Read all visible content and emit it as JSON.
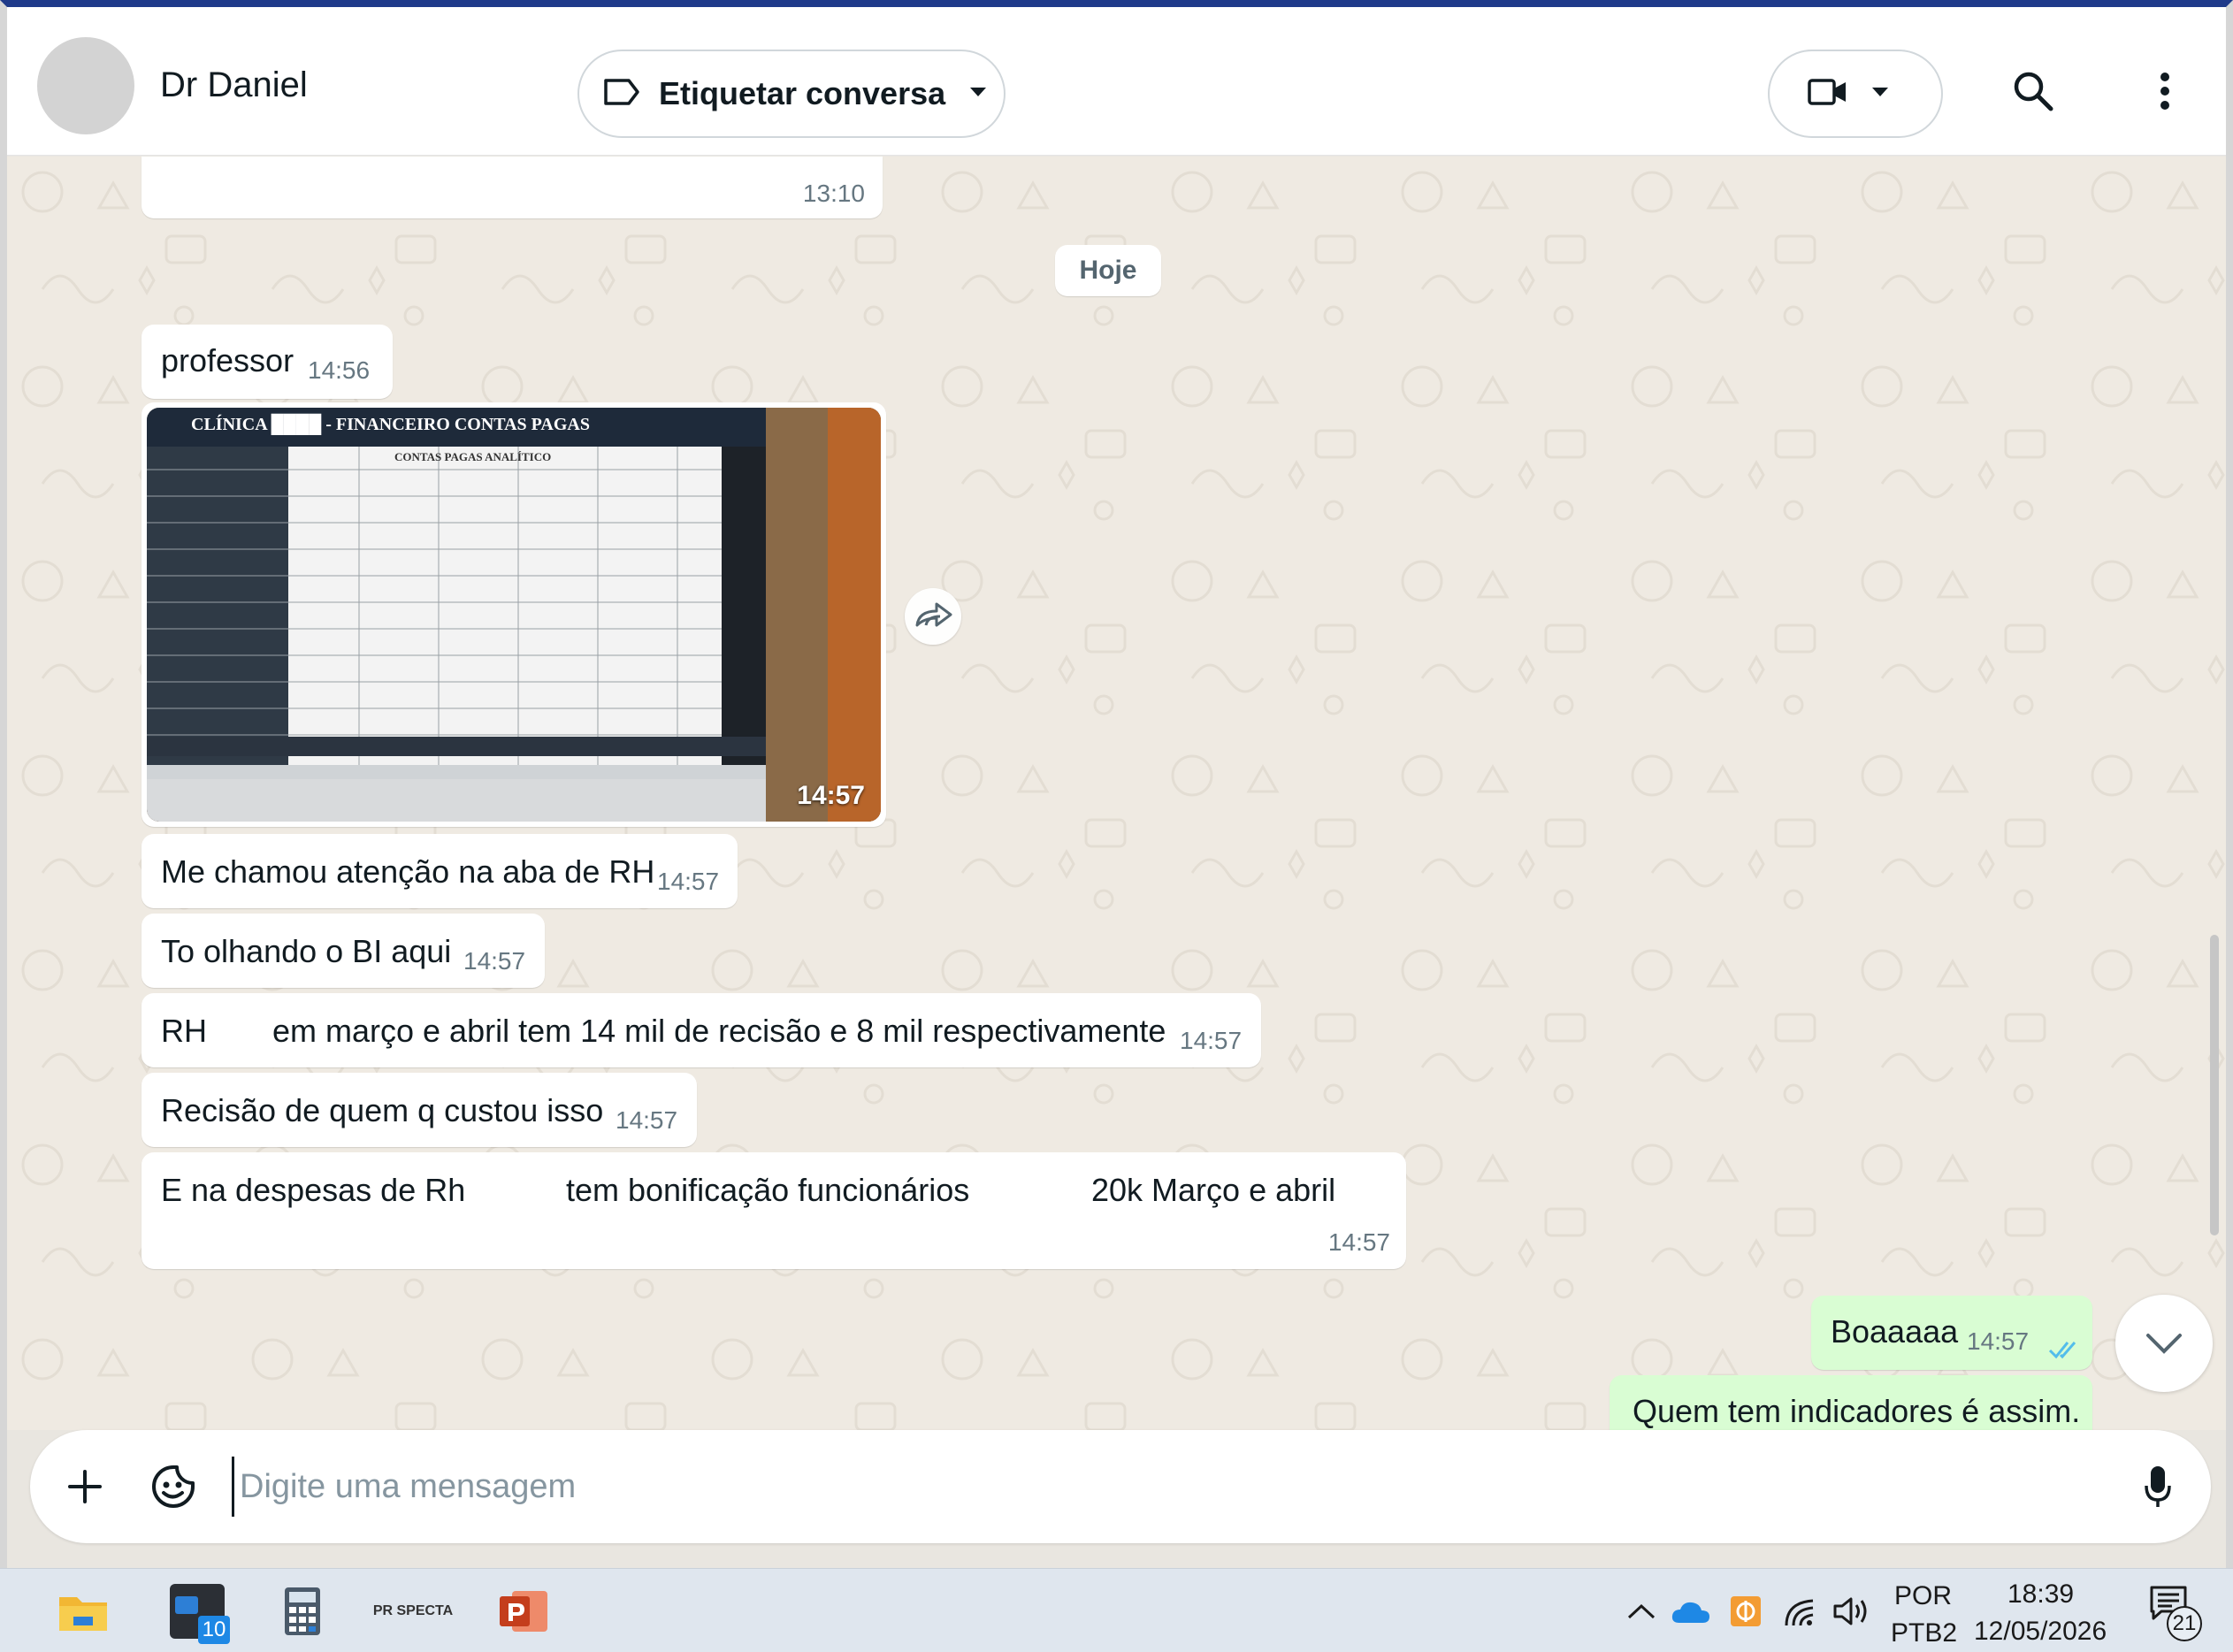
{
  "header": {
    "contact_name": "Dr Daniel",
    "label_button": "Etiquetar conversa"
  },
  "chat": {
    "date_divider": "Hoje",
    "prev_message_time": "13:10",
    "messages": [
      {
        "segments": [
          "professor"
        ],
        "time": "14:56"
      },
      {
        "type": "image",
        "image_caption_visible": "CLÍNICA ████ - FINANCEIRO CONTAS PAGAS",
        "image_subtitle": "CONTAS PAGAS ANALÍTICO",
        "time": "14:57"
      },
      {
        "segments": [
          "Me chamou atenção na aba de RH"
        ],
        "time": "14:57"
      },
      {
        "segments": [
          "To olhando o BI aqui"
        ],
        "time": "14:57"
      },
      {
        "segments": [
          "RH",
          "em março e abril tem 14 mil de recisão e 8 mil respectivamente"
        ],
        "time": "14:57"
      },
      {
        "segments": [
          "Recisão de quem q custou isso"
        ],
        "time": "14:57"
      },
      {
        "segments": [
          "E na despesas de Rh",
          "tem bonificação funcionários",
          "20k Março e abril"
        ],
        "time": "14:57"
      }
    ],
    "outgoing": [
      {
        "text": "Boaaaaa",
        "time": "14:57",
        "status": "read"
      },
      {
        "text": "Quem tem indicadores é assim."
      }
    ]
  },
  "composer": {
    "placeholder": "Digite uma mensagem"
  },
  "taskbar": {
    "calendar_badge": "10",
    "app_label": "PR SPECTA",
    "lang_top": "POR",
    "lang_bottom": "PTB2",
    "clock_time": "18:39",
    "clock_date": "12/05/2026",
    "notifications": "21"
  },
  "colors": {
    "outgoing_bubble": "#d9fdd3",
    "incoming_bubble": "#ffffff",
    "chat_bg": "#efeae2",
    "read_ticks": "#53bdeb"
  }
}
